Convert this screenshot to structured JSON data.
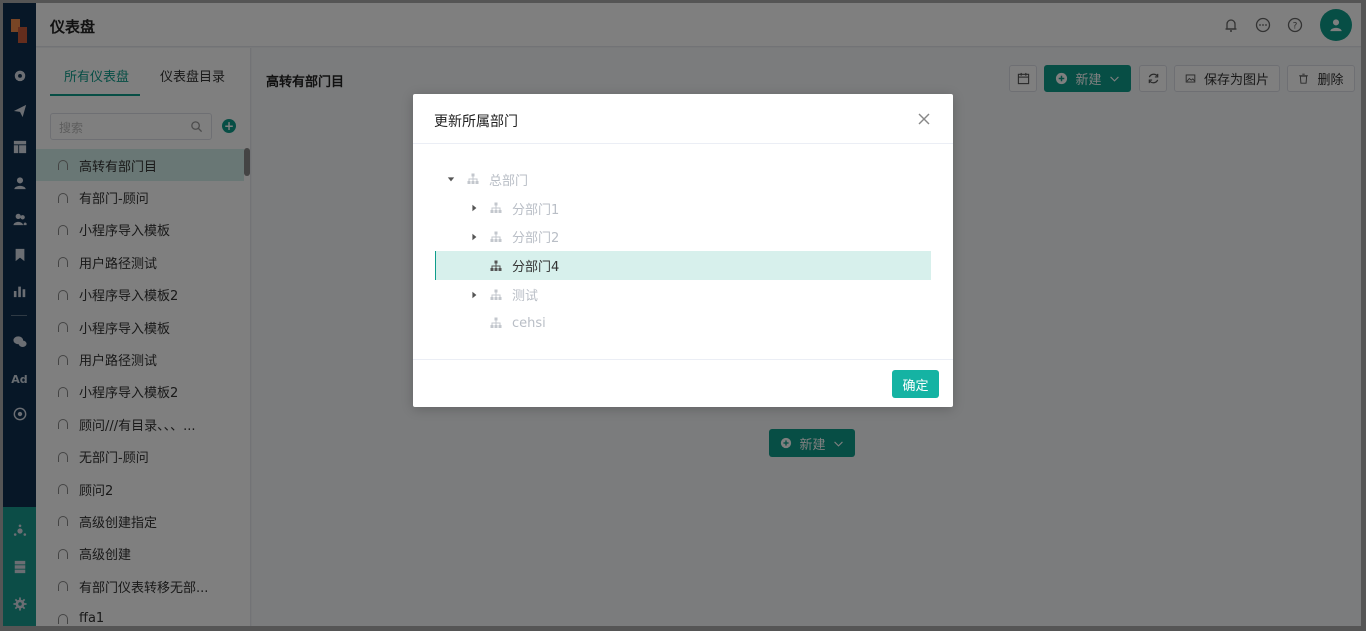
{
  "header": {
    "title": "仪表盘"
  },
  "left_panel": {
    "tabs": [
      {
        "label": "所有仪表盘",
        "active": true
      },
      {
        "label": "仪表盘目录",
        "active": false
      }
    ],
    "search_placeholder": "搜索",
    "items": [
      "高转有部门目",
      "有部门-顾问",
      "小程序导入模板",
      "用户路径测试",
      "小程序导入模板2",
      "小程序导入模板",
      "用户路径测试",
      "小程序导入模板2",
      "顾问///有目录、、、...",
      "无部门-顾问",
      "顾问2",
      "高级创建指定",
      "高级创建",
      "有部门仪表转移无部...",
      "ffa1"
    ],
    "active_index": 0
  },
  "main": {
    "title": "高转有部门目",
    "toolbar": {
      "new_label": "新建",
      "save_image_label": "保存为图片",
      "delete_label": "删除"
    },
    "center_new_label": "新建"
  },
  "modal": {
    "title": "更新所属部门",
    "tree": [
      {
        "label": "总部门",
        "level": 0,
        "arrow": "down",
        "selected": false
      },
      {
        "label": "分部门1",
        "level": 1,
        "arrow": "right",
        "selected": false
      },
      {
        "label": "分部门2",
        "level": 1,
        "arrow": "right",
        "selected": false
      },
      {
        "label": "分部门4",
        "level": 1,
        "arrow": "none",
        "selected": true
      },
      {
        "label": "测试",
        "level": 1,
        "arrow": "right",
        "selected": false
      },
      {
        "label": "cehsi",
        "level": 1,
        "arrow": "none",
        "selected": false
      }
    ],
    "ok_label": "确定"
  },
  "colors": {
    "accent": "#0e9d8b",
    "rail": "#0f2e4e",
    "selected_bg": "#d7f0ec"
  },
  "icons": [
    "dashboard-icon",
    "send-icon",
    "layout-icon",
    "user-icon",
    "users-icon",
    "bookmark-icon",
    "bar-chart-icon",
    "wechat-icon",
    "ad-icon",
    "target-icon",
    "hub-icon",
    "server-icon",
    "gear-icon",
    "bell-icon",
    "chat-icon",
    "help-icon",
    "avatar-icon",
    "search-icon",
    "calendar-icon",
    "refresh-icon",
    "image-icon",
    "trash-icon",
    "close-icon",
    "org-icon"
  ]
}
